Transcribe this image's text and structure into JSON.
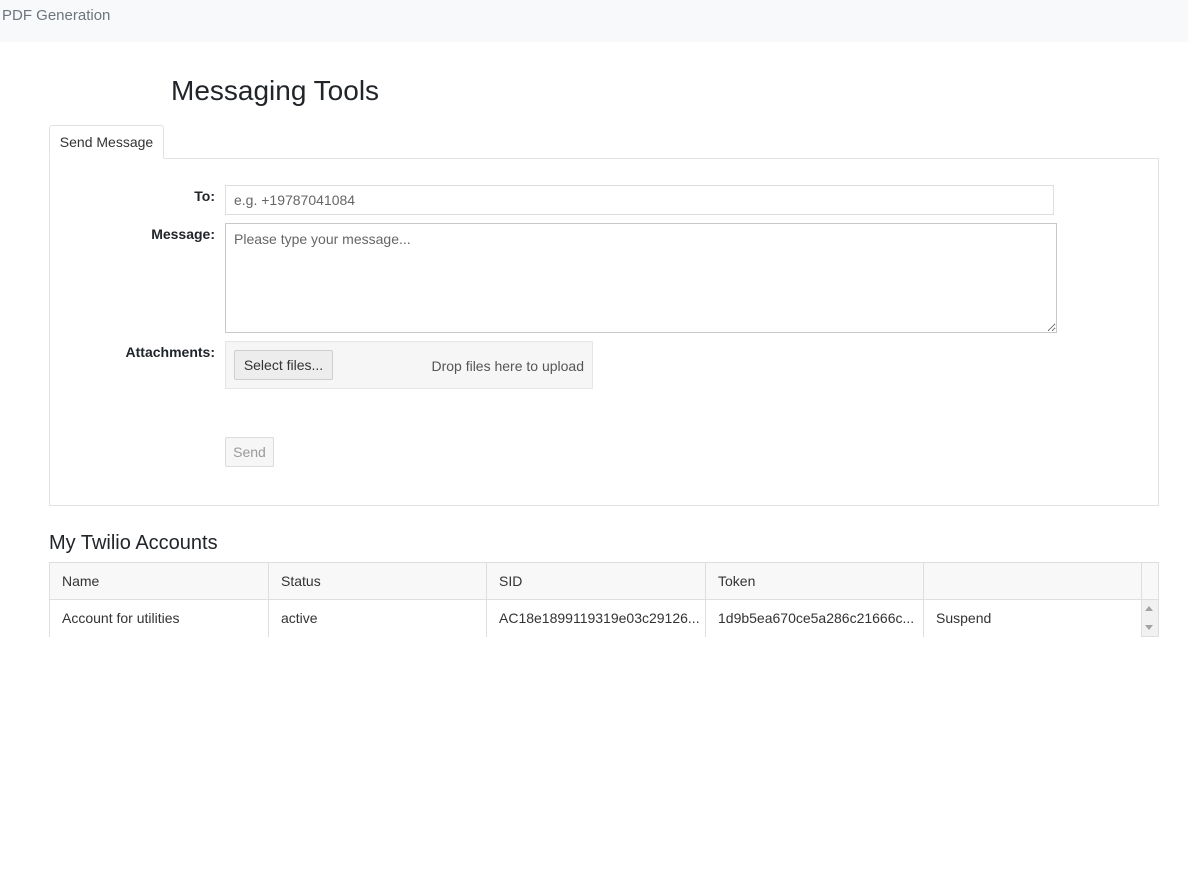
{
  "topbar": {
    "brand": "PDF Generation"
  },
  "page": {
    "title": "Messaging Tools"
  },
  "tabs": [
    {
      "label": "Send Message"
    }
  ],
  "form": {
    "to_label": "To:",
    "to_placeholder": "e.g. +19787041084",
    "message_label": "Message:",
    "message_placeholder": "Please type your message...",
    "attachments_label": "Attachments:",
    "select_files_label": "Select files...",
    "drop_text": "Drop files here to upload",
    "send_label": "Send"
  },
  "accounts": {
    "title": "My Twilio Accounts",
    "columns": [
      "Name",
      "Status",
      "SID",
      "Token",
      ""
    ],
    "rows": [
      {
        "name": "Account for utilities",
        "status": "active",
        "sid": "AC18e1899119319e03c29126...",
        "token": "1d9b5ea670ce5a286c21666c...",
        "action": "Suspend"
      }
    ]
  }
}
